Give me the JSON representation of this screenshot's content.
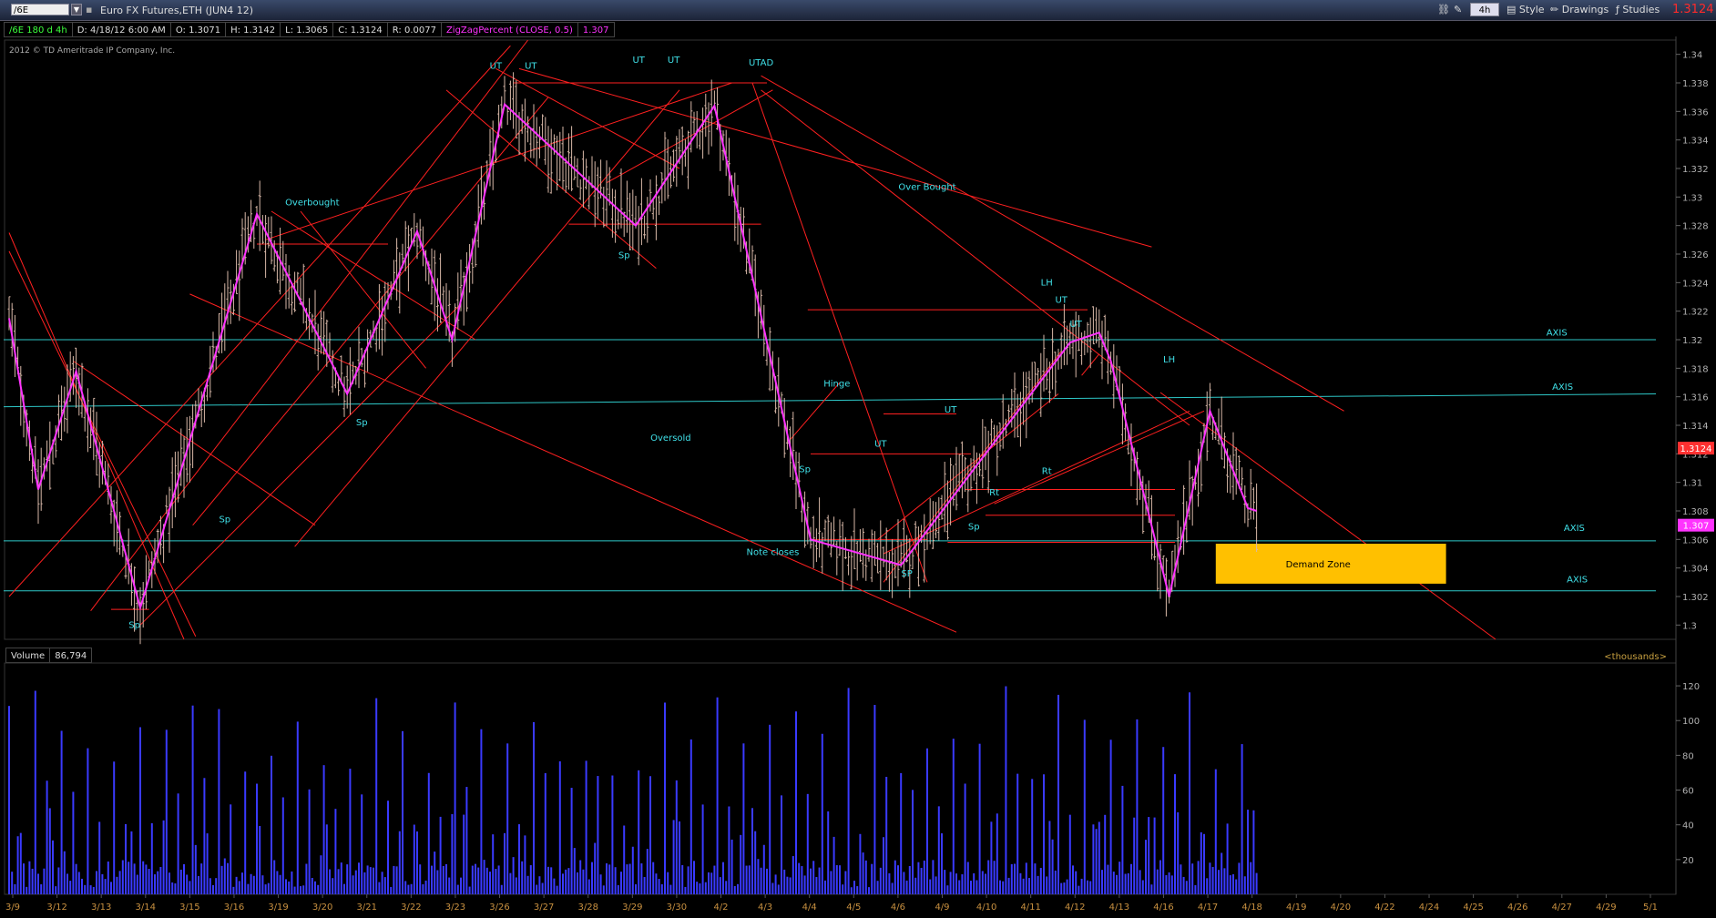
{
  "header": {
    "symbol": "/6E",
    "title": "Euro FX Futures,ETH (JUN4 12)",
    "aggregation": "4h",
    "style_label": "Style",
    "drawings_label": "Drawings",
    "studies_label": "Studies",
    "last_price": "1.3124"
  },
  "infobar": {
    "symbol_period": "/6E 180 d 4h",
    "date": "D: 4/18/12 6:00 AM",
    "open": "O: 1.3071",
    "high": "H: 1.3142",
    "low": "L: 1.3065",
    "close": "C: 1.3124",
    "range": "R: 0.0077",
    "study": "ZigZagPercent (CLOSE, 0.5)",
    "study_value": "1.307"
  },
  "colors": {
    "bar": "#d8b8a8",
    "zigzag": "#ff33ff",
    "trendline": "#ff2020",
    "axis_line": "#2ec8c8",
    "label": "#40e0e8",
    "volume": "#3a3aff",
    "demand_zone": "#ffc000",
    "grid_text": "#b0b0b0",
    "date_text": "#c89040"
  },
  "chart_data": [
    {
      "type": "ohlc",
      "copyright": "2012 © TD Ameritrade IP Company, Inc.",
      "ylim": [
        1.299,
        1.341
      ],
      "y_ticks": [
        "1.34",
        "1.338",
        "1.336",
        "1.334",
        "1.332",
        "1.33",
        "1.328",
        "1.326",
        "1.324",
        "1.322",
        "1.32",
        "1.318",
        "1.316",
        "1.314",
        "1.312",
        "1.31",
        "1.308",
        "1.306",
        "1.304",
        "1.302",
        "1.3"
      ],
      "x_ticks": [
        "3/9",
        "3/12",
        "3/13",
        "3/14",
        "3/15",
        "3/16",
        "3/19",
        "3/20",
        "3/21",
        "3/22",
        "3/23",
        "3/26",
        "3/27",
        "3/28",
        "3/29",
        "3/30",
        "4/2",
        "4/3",
        "4/4",
        "4/5",
        "4/6",
        "4/9",
        "4/10",
        "4/11",
        "4/12",
        "4/13",
        "4/16",
        "4/17",
        "4/18",
        "4/19",
        "4/20",
        "4/22",
        "4/24",
        "4/25",
        "4/26",
        "4/27",
        "4/29",
        "5/1"
      ],
      "price_tags": [
        {
          "value": 1.3124,
          "label": "1.3124",
          "color": "#ff3030"
        },
        {
          "value": 1.307,
          "label": "1.307",
          "color": "#ff33ff"
        }
      ],
      "zigzag_points": [
        [
          0,
          1.3215
        ],
        [
          10,
          1.3095
        ],
        [
          23,
          1.3178
        ],
        [
          45,
          1.3012
        ],
        [
          85,
          1.3288
        ],
        [
          116,
          1.3162
        ],
        [
          140,
          1.3276
        ],
        [
          152,
          1.32
        ],
        [
          170,
          1.3365
        ],
        [
          215,
          1.328
        ],
        [
          242,
          1.3364
        ],
        [
          275,
          1.306
        ],
        [
          306,
          1.3042
        ],
        [
          364,
          1.3198
        ],
        [
          374,
          1.3205
        ],
        [
          378,
          1.3185
        ],
        [
          398,
          1.302
        ],
        [
          412,
          1.315
        ],
        [
          425,
          1.3082
        ],
        [
          428,
          1.308
        ]
      ],
      "axis_lines": [
        {
          "label": "AXIS",
          "from": [
            0,
            1.32
          ],
          "to": [
            565,
            1.32
          ]
        },
        {
          "label": "AXIS",
          "from": [
            0,
            1.3153
          ],
          "to": [
            565,
            1.3162
          ]
        },
        {
          "label": "AXIS",
          "from": [
            0,
            1.3059
          ],
          "to": [
            565,
            1.3059
          ]
        },
        {
          "label": "AXIS",
          "from": [
            0,
            1.3024
          ],
          "to": [
            565,
            1.3024
          ]
        }
      ],
      "demand_zone": {
        "label": "Demand Zone",
        "from": 414,
        "to": 493,
        "top": 1.3057,
        "bottom": 1.3029
      },
      "annotations": [
        {
          "text": "UT",
          "i": 167,
          "v": 1.339
        },
        {
          "text": "UT",
          "i": 179,
          "v": 1.339
        },
        {
          "text": "UT",
          "i": 216,
          "v": 1.3394
        },
        {
          "text": "UT",
          "i": 228,
          "v": 1.3394
        },
        {
          "text": "UTAD",
          "i": 258,
          "v": 1.3392
        },
        {
          "text": "Overbought",
          "i": 104,
          "v": 1.3294
        },
        {
          "text": "Over Bought",
          "i": 315,
          "v": 1.3305
        },
        {
          "text": "Sp",
          "i": 211,
          "v": 1.3257
        },
        {
          "text": "Sp",
          "i": 74,
          "v": 1.3072
        },
        {
          "text": "Sp",
          "i": 121,
          "v": 1.314
        },
        {
          "text": "Sp",
          "i": 43,
          "v": 1.2998
        },
        {
          "text": "Oversold",
          "i": 227,
          "v": 1.3129
        },
        {
          "text": "Hinge",
          "i": 284,
          "v": 1.3167
        },
        {
          "text": "Sp",
          "i": 273,
          "v": 1.3107
        },
        {
          "text": "UT",
          "i": 299,
          "v": 1.3125
        },
        {
          "text": "Note closes",
          "i": 262,
          "v": 1.3049
        },
        {
          "text": "SP",
          "i": 308,
          "v": 1.3034
        },
        {
          "text": "UT",
          "i": 323,
          "v": 1.3149
        },
        {
          "text": "Sp",
          "i": 331,
          "v": 1.3067
        },
        {
          "text": "Rt",
          "i": 338,
          "v": 1.3091
        },
        {
          "text": "Rt",
          "i": 356,
          "v": 1.3106
        },
        {
          "text": "LH",
          "i": 356,
          "v": 1.3238
        },
        {
          "text": "UT",
          "i": 361,
          "v": 1.3226
        },
        {
          "text": "UT",
          "i": 366,
          "v": 1.3209
        },
        {
          "text": "LH",
          "i": 398,
          "v": 1.3184
        },
        {
          "text": "AXIS",
          "i": 531,
          "v": 1.3203
        },
        {
          "text": "AXIS",
          "i": 533,
          "v": 1.3165
        },
        {
          "text": "AXIS",
          "i": 537,
          "v": 1.3066
        },
        {
          "text": "AXIS",
          "i": 538,
          "v": 1.303
        }
      ]
    },
    {
      "type": "bar",
      "title": "Volume",
      "value_label": "86,794",
      "unit_label": "<thousands>",
      "ylim": [
        0,
        130
      ],
      "y_ticks": [
        "120",
        "100",
        "80",
        "60",
        "40",
        "20"
      ]
    }
  ]
}
